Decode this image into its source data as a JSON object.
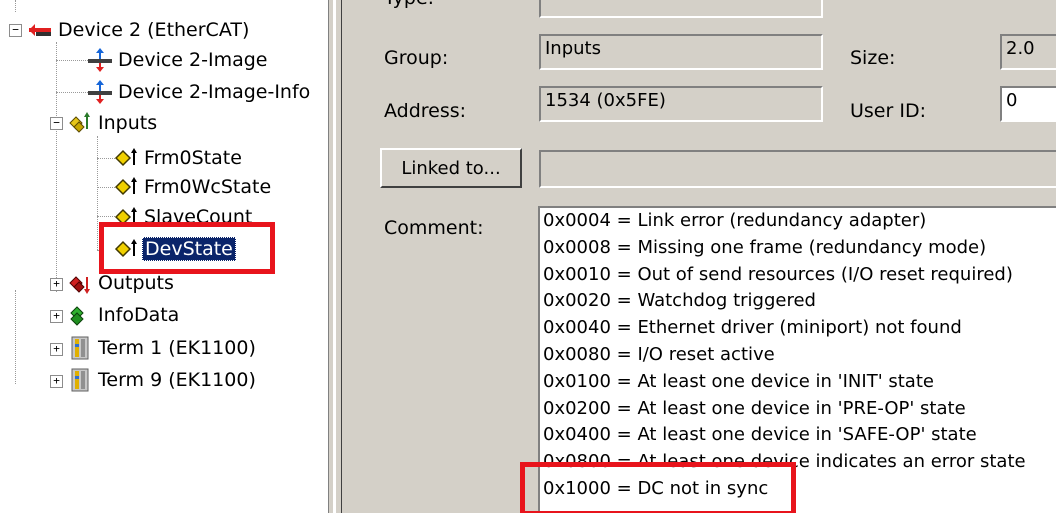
{
  "tree": {
    "expander_plus": "+",
    "expander_minus": "−",
    "items": [
      {
        "label": "Device 2 (EtherCAT)"
      },
      {
        "label": "Device 2-Image"
      },
      {
        "label": "Device 2-Image-Info"
      },
      {
        "label": "Inputs"
      },
      {
        "label": "Frm0State"
      },
      {
        "label": "Frm0WcState"
      },
      {
        "label": "SlaveCount"
      },
      {
        "label": "DevState"
      },
      {
        "label": "Outputs"
      },
      {
        "label": "InfoData"
      },
      {
        "label": "Term 1 (EK1100)"
      },
      {
        "label": "Term 9 (EK1100)"
      }
    ],
    "selected": "DevState",
    "highlight_color": "#e8141c"
  },
  "properties": {
    "type_label": "Type:",
    "group_label": "Group:",
    "group_value": "Inputs",
    "size_label": "Size:",
    "size_value": "2.0",
    "address_label": "Address:",
    "address_value": "1534 (0x5FE)",
    "user_id_label": "User ID:",
    "user_id_value": "0",
    "linked_button": "Linked to...",
    "linked_value": "",
    "comment_label": "Comment:",
    "comment_lines": [
      "0x0004 = Link error (redundancy adapter)",
      "0x0008 = Missing one frame (redundancy mode)",
      "0x0010 = Out of send resources (I/O reset required)",
      "0x0020 = Watchdog triggered",
      "0x0040 = Ethernet driver (miniport) not found",
      "0x0080 = I/O reset active",
      "0x0100 = At least one device in 'INIT' state",
      "0x0200 = At least one device in 'PRE-OP' state",
      "0x0400 = At least one device in 'SAFE-OP' state",
      "0x0800 = At least one device indicates an error state",
      "0x1000 = DC not in sync"
    ]
  },
  "colors": {
    "panel": "#d4d0c8",
    "selection": "#0a246a",
    "highlight": "#e8141c"
  }
}
